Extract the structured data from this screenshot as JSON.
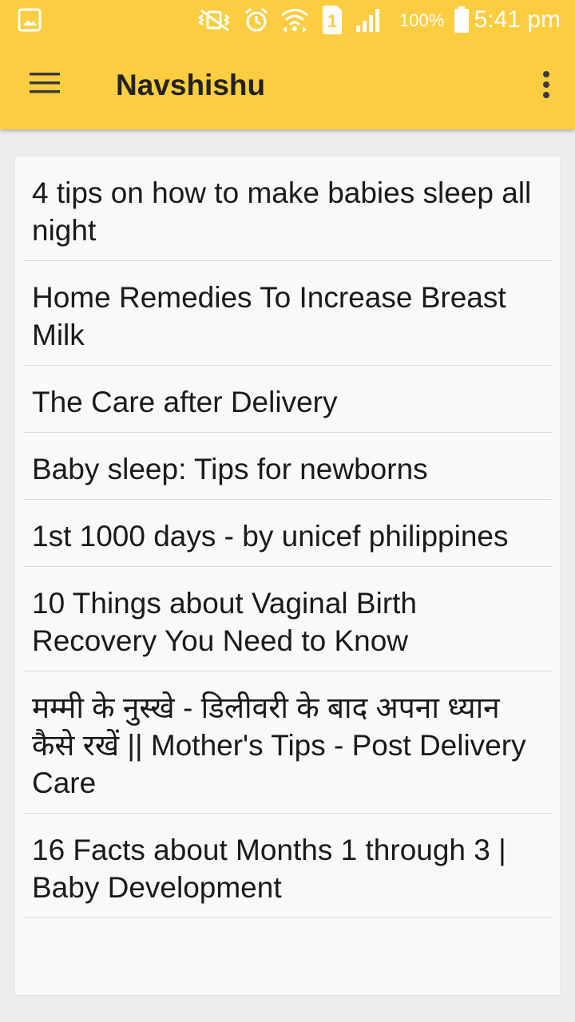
{
  "status_bar": {
    "battery_percent": "100%",
    "time": "5:41 pm",
    "sim_label": "1",
    "icons": [
      "gallery-icon",
      "mute-vibrate-icon",
      "alarm-icon",
      "wifi-icon",
      "sim-icon",
      "signal-icon",
      "battery-icon"
    ]
  },
  "app_bar": {
    "title": "Navshishu",
    "menu_icon": "hamburger-menu-icon",
    "overflow_icon": "more-vert-icon",
    "color": "#fdcd41"
  },
  "list": {
    "items": [
      "4 tips on how to make babies sleep all night",
      "Home Remedies To Increase Breast Milk",
      "The Care after Delivery",
      "Baby sleep: Tips for newborns",
      "1st 1000 days - by unicef philippines",
      "10 Things about Vaginal Birth Recovery You Need to Know",
      "मम्मी के नुस्खे - डिलीवरी के बाद अपना ध्यान कैसे रखें || Mother's Tips - Post Delivery Care",
      "16 Facts about Months 1 through 3 | Baby Development"
    ]
  }
}
